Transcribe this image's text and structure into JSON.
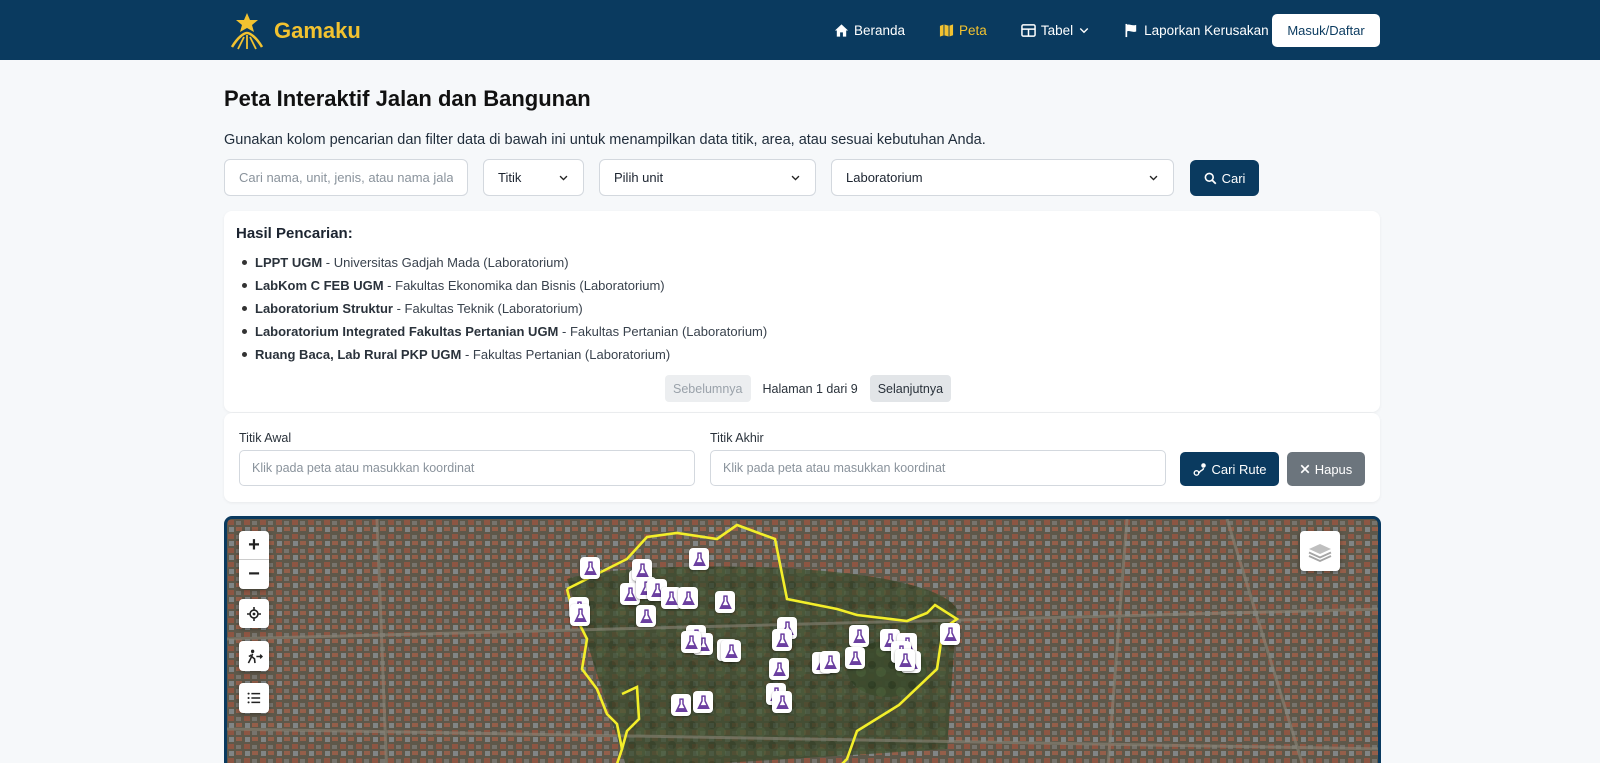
{
  "app": {
    "name": "Gamaku"
  },
  "nav": {
    "items": [
      {
        "label": "Beranda",
        "icon": "home-icon"
      },
      {
        "label": "Peta",
        "icon": "map-icon",
        "active": true
      },
      {
        "label": "Tabel",
        "icon": "table-icon",
        "dropdown": true
      },
      {
        "label": "Laporkan Kerusakan",
        "icon": "flag-icon"
      }
    ],
    "login_label": "Masuk/Daftar"
  },
  "page": {
    "title": "Peta Interaktif Jalan dan Bangunan",
    "description": "Gunakan kolom pencarian dan filter data di bawah ini untuk menampilkan data titik, area, atau sesuai kebutuhan Anda."
  },
  "search": {
    "placeholder": "Cari nama, unit, jenis, atau nama jalan/",
    "type_value": "Titik",
    "unit_value": "Pilih unit",
    "category_value": "Laboratorium",
    "button_label": "Cari"
  },
  "results": {
    "heading": "Hasil Pencarian:",
    "items": [
      {
        "name": "LPPT UGM",
        "detail": "Universitas Gadjah Mada (Laboratorium)"
      },
      {
        "name": "LabKom C FEB UGM",
        "detail": "Fakultas Ekonomika dan Bisnis (Laboratorium)"
      },
      {
        "name": "Laboratorium Struktur",
        "detail": "Fakultas Teknik (Laboratorium)"
      },
      {
        "name": "Laboratorium Integrated Fakultas Pertanian UGM",
        "detail": "Fakultas Pertanian (Laboratorium)"
      },
      {
        "name": "Ruang Baca, Lab Rural PKP UGM",
        "detail": "Fakultas Pertanian (Laboratorium)"
      }
    ],
    "separator": " - ",
    "prev_label": "Sebelumnya",
    "page_info": "Halaman 1 dari 9",
    "next_label": "Selanjutnya"
  },
  "route": {
    "start_label": "Titik Awal",
    "start_placeholder": "Klik pada peta atau masukkan koordinat",
    "end_label": "Titik Akhir",
    "end_placeholder": "Klik pada peta atau masukkan koordinat",
    "search_label": "Cari Rute",
    "clear_label": "Hapus"
  },
  "map": {
    "controls": [
      "zoom-in",
      "zoom-out",
      "locate",
      "route-walk",
      "list"
    ],
    "zoom_in_label": "+",
    "zoom_out_label": "−",
    "marker_icon": "flask-icon",
    "marker_color": "#6b3fa0",
    "boundary_color": "#f3ee2a"
  },
  "colors": {
    "primary": "#0a3a5f",
    "accent": "#f2c230",
    "secondary": "#6c757d"
  }
}
